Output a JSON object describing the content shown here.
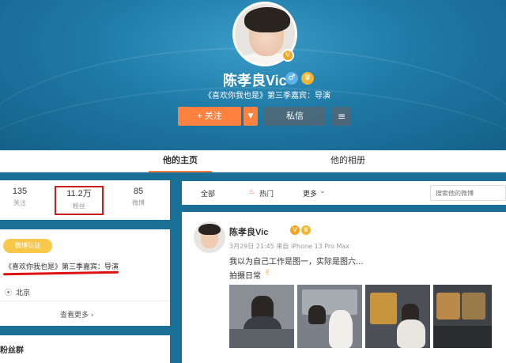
{
  "header": {
    "name": "陈孝良Vic",
    "description": "《喜欢你我也是》第三季嘉宾：导演",
    "follow_label": "+ 关注",
    "message_label": "私信"
  },
  "tabs": [
    {
      "label": "他的主页"
    },
    {
      "label": "他的相册"
    }
  ],
  "stats": [
    {
      "value": "135",
      "label": "关注"
    },
    {
      "value": "11.2万",
      "label": "粉丝"
    },
    {
      "value": "85",
      "label": "微博"
    }
  ],
  "info": {
    "verified_label": "微博认证",
    "verified_text": "《喜欢你我也是》第三季嘉宾：导演",
    "location": "北京",
    "see_more": "查看更多 ›"
  },
  "fans_group_title": "粉丝群",
  "filter": {
    "all": "全部",
    "hot": "热门",
    "more": "更多",
    "search_placeholder": "搜索他的微博"
  },
  "post": {
    "author": "陈孝良Vic",
    "meta": "3月29日 21:45 来自 iPhone 13 Pro Max",
    "text_line1": "我以为自己工作是图一，实际是图六...",
    "text_line2": "拍摄日常"
  },
  "colors": {
    "accent": "#ff8140",
    "banner": "#1f7aa6",
    "highlight_box": "#c81e1e"
  },
  "icons": [
    "vip-icon",
    "verified-icon",
    "crown-icon",
    "dropdown-icon",
    "menu-icon",
    "location-icon",
    "hot-icon",
    "chevron-down-icon"
  ]
}
